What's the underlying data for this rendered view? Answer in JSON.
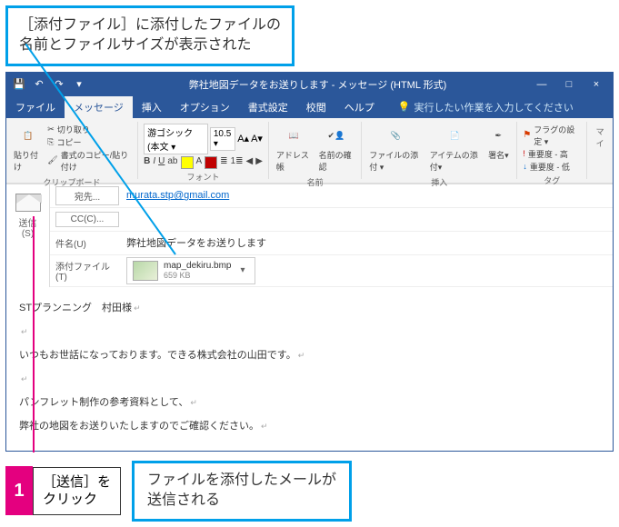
{
  "callouts": {
    "top": "［添付ファイル］に添付したファイルの\n名前とファイルサイズが表示された",
    "step_num": "1",
    "step_text": "［送信］を\nクリック",
    "bottom": "ファイルを添付したメールが\n送信される"
  },
  "window": {
    "title": "弊社地図データをお送りします - メッセージ (HTML 形式)",
    "min": "—",
    "max": "□",
    "close": "×"
  },
  "tabs": {
    "file": "ファイル",
    "message": "メッセージ",
    "insert": "挿入",
    "options": "オプション",
    "format": "書式設定",
    "review": "校閲",
    "help": "ヘルプ",
    "tellme": "実行したい作業を入力してください"
  },
  "ribbon": {
    "paste": "貼り付け",
    "cut": "切り取り",
    "copy": "コピー",
    "fmtpainter": "書式のコピー/貼り付け",
    "clipboard_label": "クリップボード",
    "font_name": "游ゴシック (本文 ▾",
    "font_size": "10.5 ▾",
    "font_label": "フォント",
    "addressbook": "アドレス帳",
    "checknames": "名前の確認",
    "names_label": "名前",
    "attachfile": "ファイルの添付 ▾",
    "attachitem": "アイテムの添付▾",
    "signature": "署名▾",
    "include_label": "挿入",
    "flag": "フラグの設定 ▾",
    "high": "重要度 - 高",
    "low": "重要度 - 低",
    "tags_label": "タグ",
    "my": "マイ"
  },
  "compose": {
    "send": "送信",
    "send_key": "(S)",
    "to_label": "宛先...",
    "to_value": "murata.stp@gmail.com",
    "cc_label": "CC(C)...",
    "cc_value": "",
    "subject_label": "件名(U)",
    "subject_value": "弊社地図データをお送りします",
    "attach_label": "添付ファイル(T)",
    "attach_name": "map_dekiru.bmp",
    "attach_size": "659 KB"
  },
  "body": {
    "l1": "STプランニング　村田様",
    "l2": "いつもお世話になっております。できる株式会社の山田です。",
    "l3": "パンフレット制作の参考資料として、",
    "l4": "弊社の地図をお送りいたしますのでご確認ください。"
  }
}
